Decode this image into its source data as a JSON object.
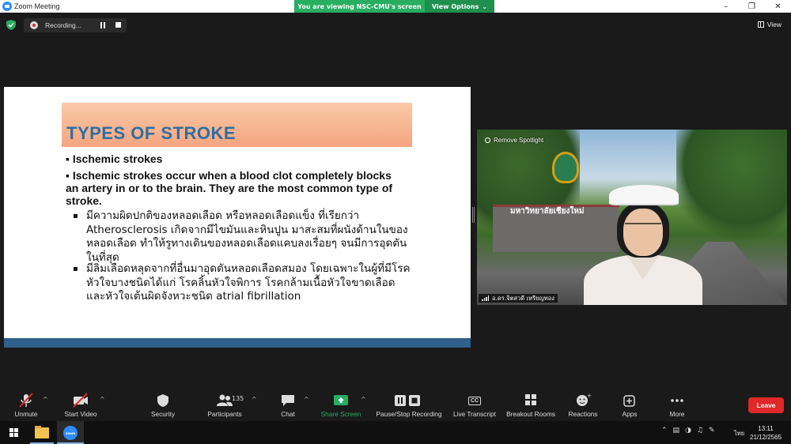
{
  "window": {
    "title": "Zoom Meeting",
    "viewing_banner": "You are viewing NSC-CMU's screen",
    "view_options": "View Options"
  },
  "top": {
    "recording_label": "Recording...",
    "view_label": "View"
  },
  "slide": {
    "title": "TYPES OF STROKE",
    "bullet1": "▪ Ischemic strokes",
    "bullet2": "▪ Ischemic strokes occur when a blood clot completely blocks an artery in or to the brain. They are the most common type of stroke.",
    "sub1": "มีความผิดปกติของหลอดเลือด หรือหลอดเลือดแข็ง ที่เรียกว่า Atherosclerosis เกิดจากมีไขมันและหินปูน มาสะสมที่ผนังด้านในของหลอดเลือด ทำให้รูทางเดินของหลอดเลือดแคบลงเรื่อยๆ จนมีการอุดตันในที่สุด",
    "sub2": "มีลิ่มเลือดหลุดจากที่อื่นมาอุดตันหลอดเลือดสมอง โดยเฉพาะในผู้ที่มีโรคหัวใจบางชนิดได้แก่ โรคลิ้นหัวใจพิการ โรคกล้ามเนื้อหัวใจขาดเลือด และหัวใจเต้นผิดจังหวะชนิด atrial fibrillation",
    "sub_marker": "▪"
  },
  "video": {
    "spotlight_label": "Remove Spotlight",
    "participant_name": "อ.ดร.จิตสวดี เหรียญทอง",
    "sign_text": "มหาวิทยาลัยเชียงใหม่"
  },
  "toolbar": {
    "unmute": "Unmute",
    "start_video": "Start Video",
    "security": "Security",
    "participants": "Participants",
    "participants_count": "135",
    "chat": "Chat",
    "share_screen": "Share Screen",
    "recording": "Pause/Stop Recording",
    "live_transcript": "Live Transcript",
    "breakout_rooms": "Breakout Rooms",
    "reactions": "Reactions",
    "apps": "Apps",
    "more": "More",
    "leave": "Leave",
    "cc_icon_text": "CC",
    "caret": "^"
  },
  "taskbar": {
    "zoom_label": "zoom",
    "lang": "ไทย",
    "time": "13:11",
    "date": "21/12/2565"
  },
  "colors": {
    "share_green": "#27ae60",
    "leave_red": "#e02828",
    "slide_title_blue": "#2e6ea3",
    "slide_bar": "#2f5f8a"
  }
}
